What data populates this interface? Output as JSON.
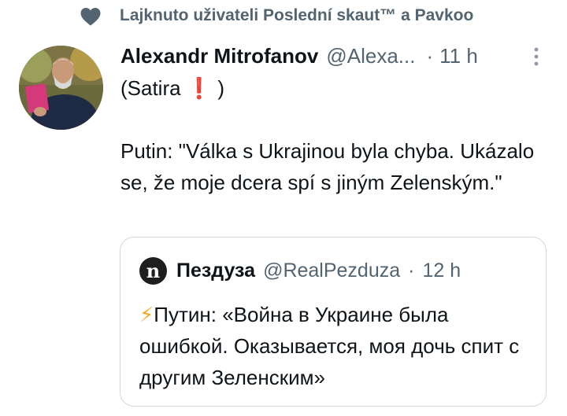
{
  "social_context": {
    "text": "Lajknuto uživateli Poslední skaut™ a Pavkoo",
    "icon": "heart-icon"
  },
  "tweet": {
    "author_name": "Alexandr Mitrofanov",
    "author_handle": "@Alexa...",
    "separator": "·",
    "time": "11 h",
    "line1_prefix": "(Satira ",
    "line1_emoji": "❗",
    "line1_suffix": " )",
    "paragraph2": "Putin: \"Válka s Ukrajinou byla chyba. Ukázalo se, že moje dcera spí s jiným Zelenským.\""
  },
  "quoted_tweet": {
    "avatar_letter": "n",
    "author_name": "Пездуза",
    "author_handle": "@RealPezduza",
    "separator": "·",
    "time": "12 h",
    "emoji": "⚡",
    "text": "Путин: «Война в Украине была ошибкой. Оказывается, моя дочь спит с другим Зеленским»"
  },
  "colors": {
    "text": "#0f1419",
    "secondary": "#536471",
    "border": "#cfd9de",
    "heart": "#536471"
  }
}
